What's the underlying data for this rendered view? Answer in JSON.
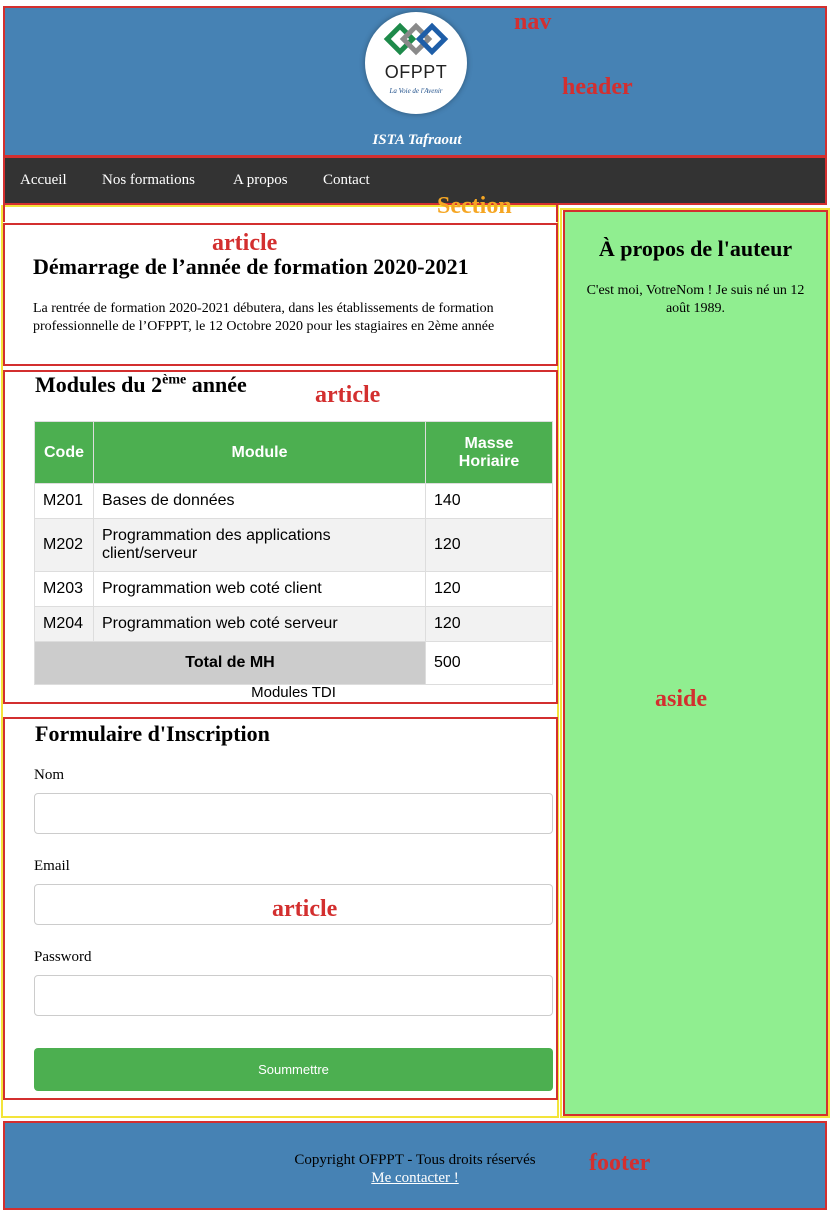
{
  "annotations": {
    "header": "header",
    "nav": "nav",
    "section": "Section",
    "article_1": "article",
    "article_2": "article",
    "article_3": "article",
    "aside": "aside",
    "footer": "footer"
  },
  "header": {
    "logo_text": "OFPPT",
    "logo_slogan": "La Voie de l'Avenir",
    "subtitle": "ISTA Tafraout"
  },
  "nav": {
    "items": [
      "Accueil",
      "Nos formations",
      "A propos",
      "Contact"
    ]
  },
  "article_1": {
    "title": "Démarrage de l’année de formation 2020-2021",
    "text": "La rentrée de formation 2020-2021 débutera, dans les établissements de formation professionnelle de l’OFPPT, le 12 Octobre 2020 pour les stagiaires en 2ème année"
  },
  "article_2": {
    "title_prefix": "Modules du 2",
    "title_sup": "ème",
    "title_suffix": " année",
    "table": {
      "headers": [
        "Code",
        "Module",
        "Masse Horiaire"
      ],
      "rows": [
        [
          "M201",
          "Bases de données",
          "140"
        ],
        [
          "M202",
          "Programmation des applications client/serveur",
          "120"
        ],
        [
          "M203",
          "Programmation web coté client",
          "120"
        ],
        [
          "M204",
          "Programmation web coté serveur",
          "120"
        ]
      ],
      "total_label": "Total de MH",
      "total_value": "500",
      "caption": "Modules TDI"
    }
  },
  "article_3": {
    "title": "Formulaire d'Inscription",
    "fields": [
      {
        "label": "Nom",
        "value": "",
        "placeholder": ""
      },
      {
        "label": "Email",
        "value": "",
        "placeholder": ""
      },
      {
        "label": "Password",
        "value": "",
        "placeholder": ""
      }
    ],
    "submit_label": "Soummettre"
  },
  "aside": {
    "title": "À propos de l'auteur",
    "text": "C'est moi, VotreNom ! Je suis né un 12 août 1989."
  },
  "footer": {
    "copyright": "Copyright OFPPT - Tous droits réservés",
    "link": "Me contacter !"
  },
  "colors": {
    "header_bg": "#4682b4",
    "nav_bg": "#333333",
    "annotation_red": "#d32f2f",
    "annotation_yellow": "#f3e43a",
    "annotation_orange": "#f5a623",
    "table_header": "#4caf50",
    "submit_bg": "#4caf50",
    "aside_bg": "#90ee90",
    "total_cell_bg": "#cccccc"
  }
}
